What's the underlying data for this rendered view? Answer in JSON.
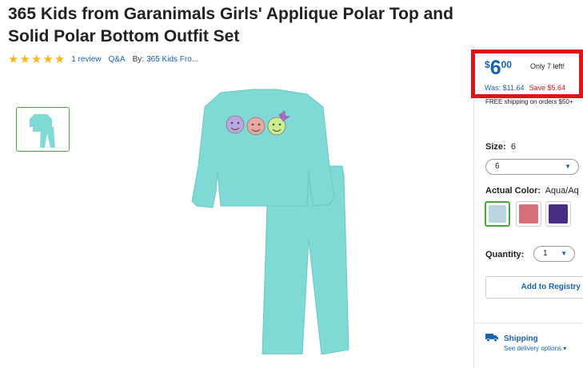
{
  "product": {
    "title": "365 Kids from Garanimals Girls' Applique Polar Top and Solid Polar Bottom Outfit Set",
    "rating_stars": 5,
    "review_link": "1 review",
    "qa_link": "Q&A",
    "by_label": "By:",
    "brand_link": "365 Kids Fro..."
  },
  "price": {
    "currency": "$",
    "dollars": "6",
    "cents": "00",
    "stock": "Only 7 left!",
    "was": "Was: $11.64",
    "save": "Save $5.64",
    "shipping_note": "FREE shipping on orders $50+"
  },
  "options": {
    "size_label": "Size:",
    "size_value": "6",
    "size_selected": "6",
    "color_label": "Actual Color:",
    "color_value": "Aqua/Aq",
    "swatches": [
      {
        "color": "#b9d6df",
        "selected": true
      },
      {
        "color": "#d4707c",
        "selected": false
      },
      {
        "color": "#4a2b84",
        "selected": false
      }
    ],
    "quantity_label": "Quantity:",
    "quantity_value": "1"
  },
  "actions": {
    "registry_button": "Add to Registry"
  },
  "shipping": {
    "title": "Shipping",
    "link": "See delivery options"
  },
  "colors": {
    "accent": "#1862b5",
    "highlight_border": "#e0121a",
    "star": "#f8b81c",
    "selected_green": "#48a83c",
    "garment": "#7fdad6"
  }
}
